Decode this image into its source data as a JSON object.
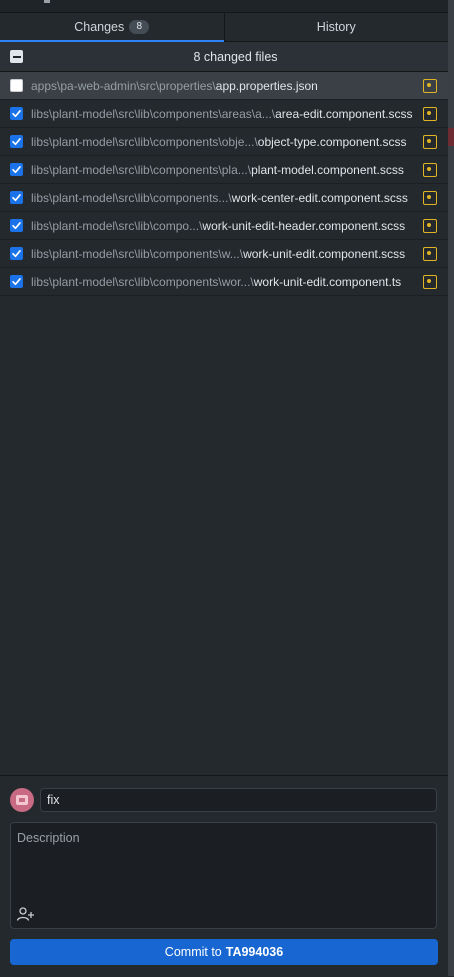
{
  "tabs": [
    {
      "label": "Changes",
      "badge": "8",
      "active": true
    },
    {
      "label": "History",
      "active": false
    }
  ],
  "changes_header": {
    "title": "8 changed files",
    "select_all_state": "indeterminate"
  },
  "files": [
    {
      "dir": "apps\\pa-web-admin\\src\\properties\\",
      "name": "app.properties.json",
      "checked": false,
      "selected": true
    },
    {
      "dir": "libs\\plant-model\\src\\lib\\components\\areas\\a...\\",
      "name": "area-edit.component.scss",
      "checked": true
    },
    {
      "dir": "libs\\plant-model\\src\\lib\\components\\obje...\\",
      "name": "object-type.component.scss",
      "checked": true
    },
    {
      "dir": "libs\\plant-model\\src\\lib\\components\\pla...\\",
      "name": "plant-model.component.scss",
      "checked": true
    },
    {
      "dir": "libs\\plant-model\\src\\lib\\components...\\",
      "name": "work-center-edit.component.scss",
      "checked": true
    },
    {
      "dir": "libs\\plant-model\\src\\lib\\compo...\\",
      "name": "work-unit-edit-header.component.scss",
      "checked": true
    },
    {
      "dir": "libs\\plant-model\\src\\lib\\components\\w...\\",
      "name": "work-unit-edit.component.scss",
      "checked": true
    },
    {
      "dir": "libs\\plant-model\\src\\lib\\components\\wor...\\",
      "name": "work-unit-edit.component.ts",
      "checked": true
    }
  ],
  "file_status_icon": "file-modified-icon",
  "colors": {
    "accent": "#2f81f7",
    "modified": "#e0b422",
    "commit_button": "#1766d1"
  },
  "commit": {
    "summary_value": "fix",
    "description_placeholder": "Description",
    "button_prefix": "Commit to",
    "branch": "TA994036"
  }
}
